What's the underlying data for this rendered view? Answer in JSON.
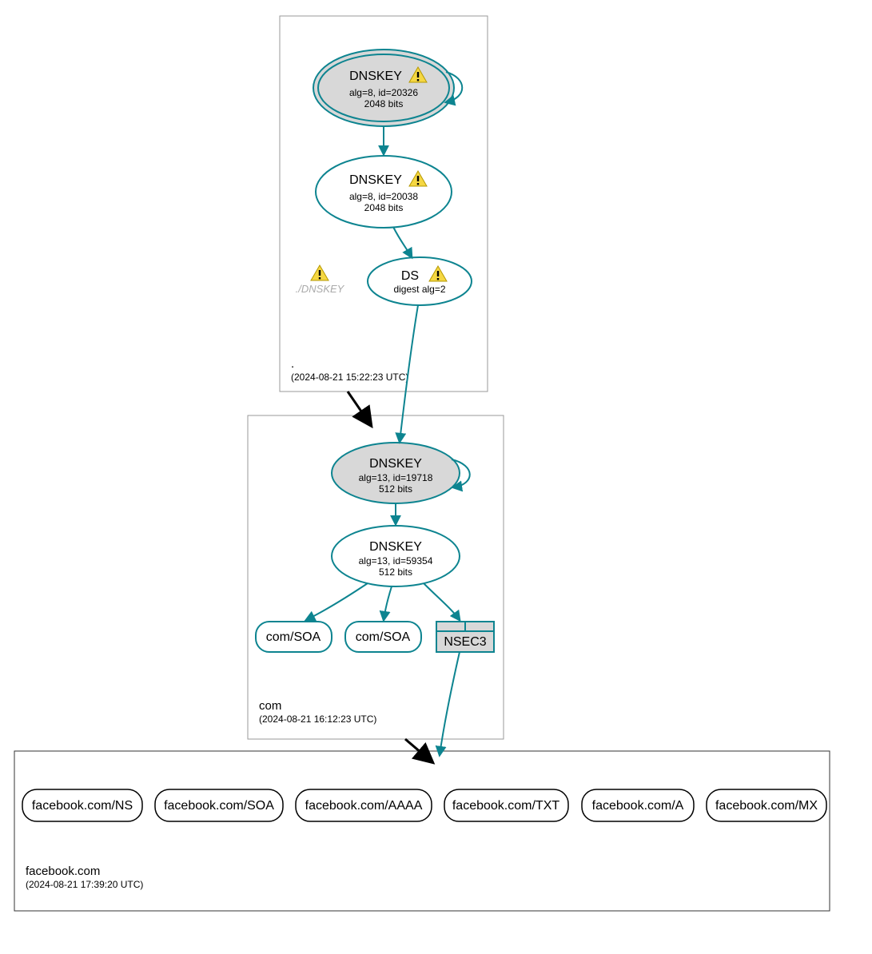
{
  "colors": {
    "teal": "#0d8490",
    "gray_fill": "#d8d8d8",
    "warn_fill": "#f5d742",
    "warn_stroke": "#b59800"
  },
  "zones": {
    "root": {
      "name": ".",
      "timestamp": "(2024-08-21 15:22:23 UTC)"
    },
    "com": {
      "name": "com",
      "timestamp": "(2024-08-21 16:12:23 UTC)"
    },
    "fb": {
      "name": "facebook.com",
      "timestamp": "(2024-08-21 17:39:20 UTC)"
    }
  },
  "nodes": {
    "root_ksk": {
      "title": "DNSKEY",
      "line1": "alg=8, id=20326",
      "line2": "2048 bits",
      "warn": true
    },
    "root_zsk": {
      "title": "DNSKEY",
      "line1": "alg=8, id=20038",
      "line2": "2048 bits",
      "warn": true
    },
    "root_dnskey_gray": {
      "label": "./DNSKEY",
      "warn": true
    },
    "root_ds": {
      "title": "DS",
      "line1": "digest alg=2",
      "warn": true
    },
    "com_ksk": {
      "title": "DNSKEY",
      "line1": "alg=13, id=19718",
      "line2": "512 bits"
    },
    "com_zsk": {
      "title": "DNSKEY",
      "line1": "alg=13, id=59354",
      "line2": "512 bits"
    },
    "com_soa1": {
      "label": "com/SOA"
    },
    "com_soa2": {
      "label": "com/SOA"
    },
    "com_nsec3": {
      "label": "NSEC3"
    },
    "fb_ns": {
      "label": "facebook.com/NS"
    },
    "fb_soa": {
      "label": "facebook.com/SOA"
    },
    "fb_aaaa": {
      "label": "facebook.com/AAAA"
    },
    "fb_txt": {
      "label": "facebook.com/TXT"
    },
    "fb_a": {
      "label": "facebook.com/A"
    },
    "fb_mx": {
      "label": "facebook.com/MX"
    }
  }
}
